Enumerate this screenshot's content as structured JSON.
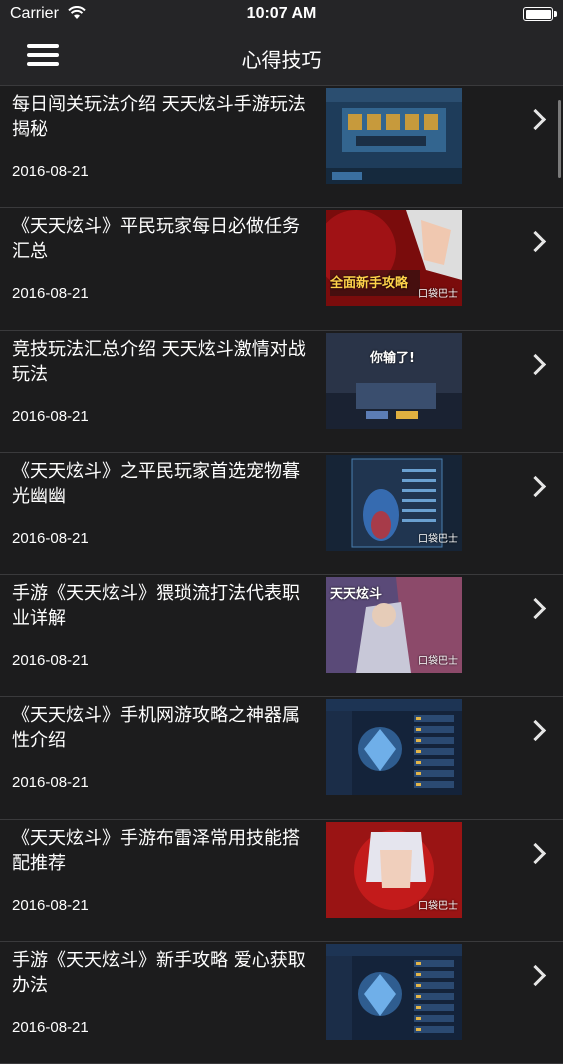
{
  "status_bar": {
    "carrier": "Carrier",
    "time": "10:07 AM",
    "battery_level": 1.0
  },
  "nav": {
    "title": "心得技巧",
    "menu_icon": "hamburger-menu-icon"
  },
  "articles": [
    {
      "title": "每日闯关玩法介绍 天天炫斗手游玩法揭秘",
      "date": "2016-08-21",
      "thumb_overlay": "",
      "thumb_brand": "",
      "thumb_style": "lobby"
    },
    {
      "title": "《天天炫斗》平民玩家每日必做任务汇总",
      "date": "2016-08-21",
      "thumb_overlay": "全面新手攻略",
      "thumb_brand": "口袋巴士",
      "thumb_style": "red"
    },
    {
      "title": "竞技玩法汇总介绍 天天炫斗激情对战玩法",
      "date": "2016-08-21",
      "thumb_overlay": "你输了!",
      "thumb_brand": "",
      "thumb_style": "battle"
    },
    {
      "title": "《天天炫斗》之平民玩家首选宠物暮光幽幽",
      "date": "2016-08-21",
      "thumb_overlay": "",
      "thumb_brand": "口袋巴士",
      "thumb_style": "pet"
    },
    {
      "title": "手游《天天炫斗》猥琐流打法代表职业详解",
      "date": "2016-08-21",
      "thumb_overlay": "天天炫斗",
      "thumb_brand": "口袋巴士",
      "thumb_style": "poster"
    },
    {
      "title": "《天天炫斗》手机网游攻略之神器属性介绍",
      "date": "2016-08-21",
      "thumb_overlay": "",
      "thumb_brand": "",
      "thumb_style": "artifact"
    },
    {
      "title": "《天天炫斗》手游布雷泽常用技能搭配推荐",
      "date": "2016-08-21",
      "thumb_overlay": "",
      "thumb_brand": "口袋巴士",
      "thumb_style": "hero"
    },
    {
      "title": "手游《天天炫斗》新手攻略 爱心获取办法",
      "date": "2016-08-21",
      "thumb_overlay": "",
      "thumb_brand": "",
      "thumb_style": "artifact"
    }
  ]
}
